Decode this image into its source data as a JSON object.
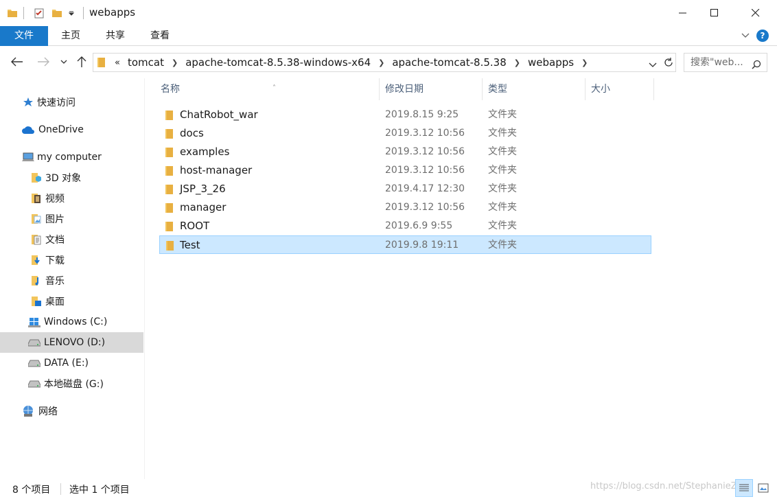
{
  "window": {
    "title": "webapps",
    "controls": [
      "minimize",
      "maximize",
      "close"
    ]
  },
  "ribbon": {
    "tabs": [
      "文件",
      "主页",
      "共享",
      "查看"
    ]
  },
  "address": {
    "overflow": "«",
    "crumbs": [
      "tomcat",
      "apache-tomcat-8.5.38-windows-x64",
      "apache-tomcat-8.5.38",
      "webapps"
    ],
    "search_placeholder": "搜索\"web..."
  },
  "sidebar": {
    "items": [
      {
        "label": "快速访问",
        "icon": "star-icon"
      },
      {
        "label": "OneDrive",
        "icon": "cloud-icon"
      },
      {
        "label": "my computer",
        "icon": "computer-icon"
      },
      {
        "label": "3D 对象",
        "icon": "3d-objects-icon"
      },
      {
        "label": "视频",
        "icon": "video-folder-icon"
      },
      {
        "label": "图片",
        "icon": "pictures-folder-icon"
      },
      {
        "label": "文档",
        "icon": "documents-folder-icon"
      },
      {
        "label": "下载",
        "icon": "downloads-folder-icon"
      },
      {
        "label": "音乐",
        "icon": "music-folder-icon"
      },
      {
        "label": "桌面",
        "icon": "desktop-folder-icon"
      },
      {
        "label": "Windows (C:)",
        "icon": "windows-drive-icon"
      },
      {
        "label": "LENOVO (D:)",
        "icon": "drive-icon",
        "selected": true
      },
      {
        "label": "DATA (E:)",
        "icon": "drive-icon"
      },
      {
        "label": "本地磁盘 (G:)",
        "icon": "drive-icon"
      },
      {
        "label": "网络",
        "icon": "network-icon"
      }
    ]
  },
  "columns": {
    "name": "名称",
    "date": "修改日期",
    "type": "类型",
    "size": "大小"
  },
  "files": [
    {
      "name": "ChatRobot_war",
      "date": "2019.8.15 9:25",
      "type": "文件夹",
      "selected": false
    },
    {
      "name": "docs",
      "date": "2019.3.12 10:56",
      "type": "文件夹",
      "selected": false
    },
    {
      "name": "examples",
      "date": "2019.3.12 10:56",
      "type": "文件夹",
      "selected": false
    },
    {
      "name": "host-manager",
      "date": "2019.3.12 10:56",
      "type": "文件夹",
      "selected": false
    },
    {
      "name": "JSP_3_26",
      "date": "2019.4.17 12:30",
      "type": "文件夹",
      "selected": false
    },
    {
      "name": "manager",
      "date": "2019.3.12 10:56",
      "type": "文件夹",
      "selected": false
    },
    {
      "name": "ROOT",
      "date": "2019.6.9 9:55",
      "type": "文件夹",
      "selected": false
    },
    {
      "name": "Test",
      "date": "2019.9.8 19:11",
      "type": "文件夹",
      "selected": true
    }
  ],
  "status": {
    "item_count": "8 个项目",
    "selected_count": "选中 1 个项目",
    "watermark": "https://blog.csdn.net/StephanieZI"
  },
  "colors": {
    "accent": "#1979ca",
    "selection": "#cce8ff",
    "selection_border": "#99d1ff",
    "folder": "#f2c55c"
  }
}
